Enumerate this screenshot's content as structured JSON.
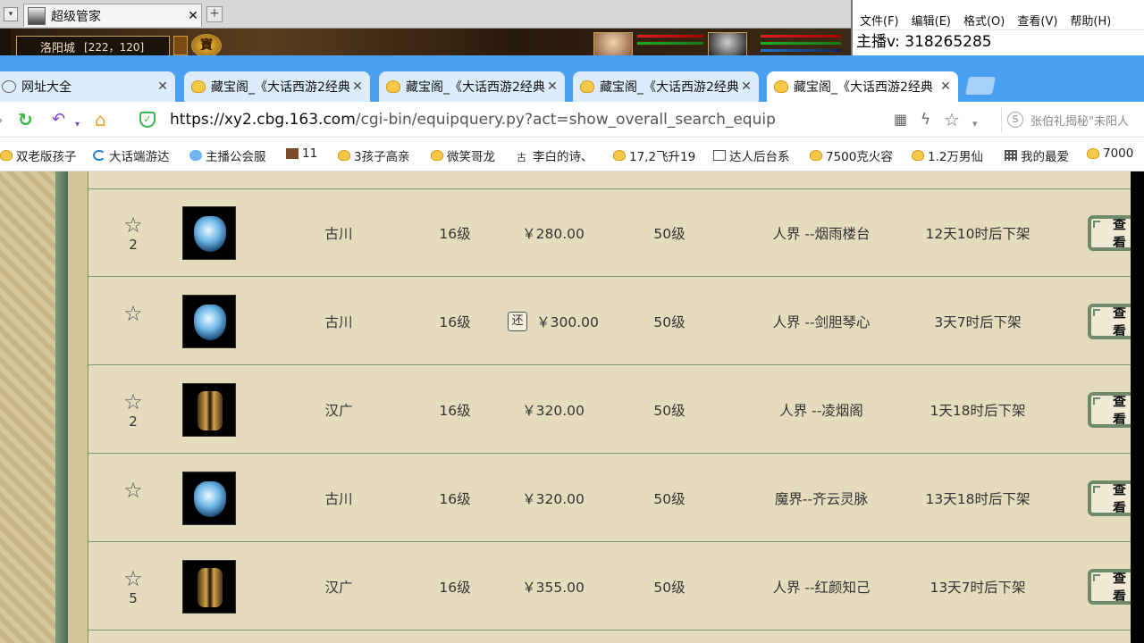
{
  "game": {
    "tab_title": "超级管家",
    "location": "洛阳城",
    "coords": "[222，120]",
    "treasure_glyph": "寶"
  },
  "notepad": {
    "menu": [
      "文件(F)",
      "编辑(E)",
      "格式(O)",
      "查看(V)",
      "帮助(H)"
    ],
    "text": "主播v:  318265285"
  },
  "browser": {
    "tabs": [
      {
        "label": "网址大全",
        "icon": "globe-icon"
      },
      {
        "label": "藏宝阁_《大话西游2经典",
        "icon": "duck-icon"
      },
      {
        "label": "藏宝阁_《大话西游2经典",
        "icon": "duck-icon"
      },
      {
        "label": "藏宝阁_《大话西游2经典",
        "icon": "duck-icon"
      },
      {
        "label": "藏宝阁_《大话西游2经典",
        "icon": "duck-icon"
      }
    ],
    "url_host": "https://xy2.cbg.163.com",
    "url_path": "/cgi-bin/equipquery.py?act=show_overall_search_equip",
    "search_hint": "张伯礼揭秘\"未阳人",
    "bookmarks": [
      {
        "label": "双老版孩子",
        "icon": "duck"
      },
      {
        "label": "大话端游达",
        "icon": "c"
      },
      {
        "label": "主播公会服",
        "icon": "cloud"
      },
      {
        "label": "11",
        "icon": "img"
      },
      {
        "label": "3孩子高亲",
        "icon": "duck"
      },
      {
        "label": "微笑哥龙",
        "icon": "duck"
      },
      {
        "label": "李白的诗、",
        "icon": "gu"
      },
      {
        "label": "17,2飞升19",
        "icon": "duck"
      },
      {
        "label": "达人后台系",
        "icon": "doc"
      },
      {
        "label": "7500克火容",
        "icon": "duck"
      },
      {
        "label": "1.2万男仙",
        "icon": "duck"
      },
      {
        "label": "我的最爱",
        "icon": "grid"
      },
      {
        "label": "7000",
        "icon": "duck"
      }
    ]
  },
  "listing": {
    "view_label": "查看",
    "haggle_label": "还",
    "rows": [
      {
        "fav_count": "2",
        "thumb": "blue",
        "seller": "古川",
        "level": "16级",
        "price": "￥280.00",
        "haggle": false,
        "req_level": "50级",
        "server": "人界 --烟雨楼台",
        "time_left": "12天10时后下架"
      },
      {
        "fav_count": "",
        "thumb": "blue",
        "seller": "古川",
        "level": "16级",
        "price": "￥300.00",
        "haggle": true,
        "req_level": "50级",
        "server": "人界 --剑胆琴心",
        "time_left": "3天7时后下架"
      },
      {
        "fav_count": "2",
        "thumb": "gold",
        "seller": "汉广",
        "level": "16级",
        "price": "￥320.00",
        "haggle": false,
        "req_level": "50级",
        "server": "人界 --凌烟阁",
        "time_left": "1天18时后下架"
      },
      {
        "fav_count": "",
        "thumb": "blue",
        "seller": "古川",
        "level": "16级",
        "price": "￥320.00",
        "haggle": false,
        "req_level": "50级",
        "server": "魔界--齐云灵脉",
        "time_left": "13天18时后下架"
      },
      {
        "fav_count": "5",
        "thumb": "gold",
        "seller": "汉广",
        "level": "16级",
        "price": "￥355.00",
        "haggle": false,
        "req_level": "50级",
        "server": "人界 --红颜知己",
        "time_left": "13天7时后下架"
      }
    ]
  }
}
